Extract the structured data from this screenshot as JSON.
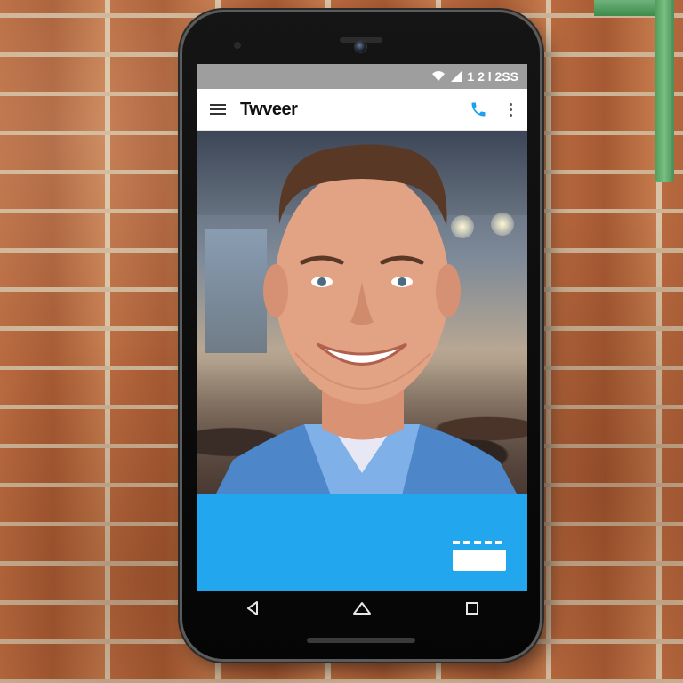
{
  "status_bar": {
    "text": "1 2 l 2SS"
  },
  "app_bar": {
    "title": "Twveer"
  },
  "icons": {
    "menu": "hamburger-menu-icon",
    "phone": "phone-icon",
    "more": "more-vertical-icon",
    "back": "back-triangle-icon",
    "home": "home-icon",
    "recents": "recents-square-icon"
  },
  "colors": {
    "accent": "#22a7ee",
    "app_bar": "#ffffff",
    "status_bar": "#9e9e9e"
  }
}
